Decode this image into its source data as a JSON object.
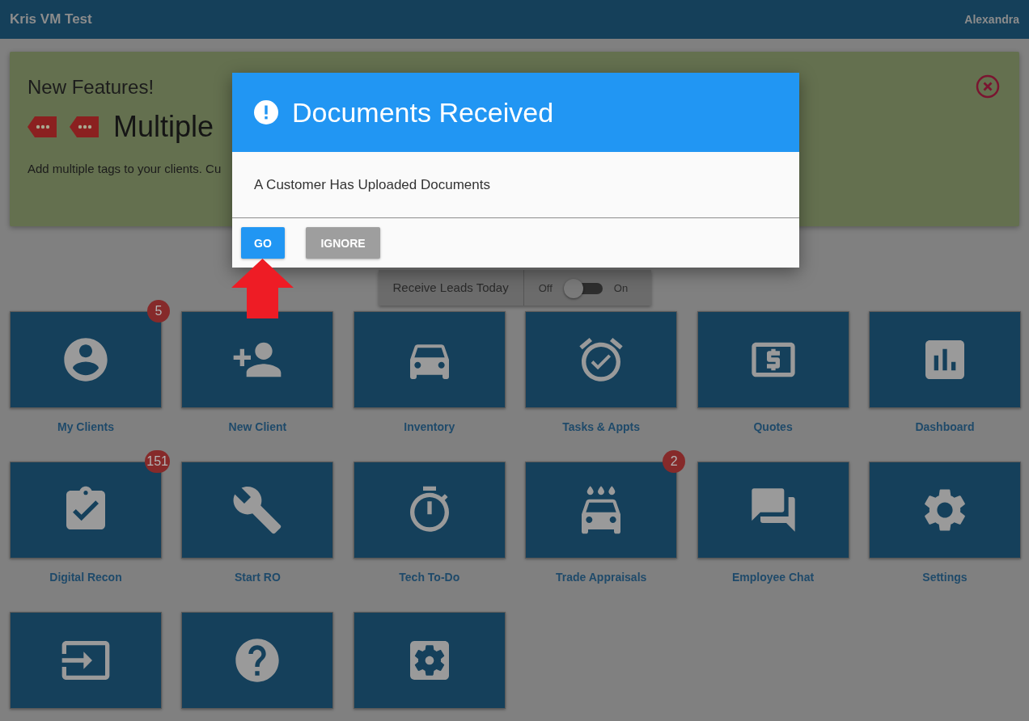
{
  "app_bar": {
    "title": "Kris VM Test",
    "user": "Alexandra"
  },
  "banner": {
    "heading": "New Features!",
    "feature_title": "Multiple",
    "description": "Add multiple tags to your clients. Cu"
  },
  "leads_toggle": {
    "label": "Receive Leads Today",
    "off_label": "Off",
    "on_label": "On",
    "on": false
  },
  "tiles": [
    {
      "label": "My Clients",
      "kind": "person",
      "badge": "5"
    },
    {
      "label": "New Client",
      "kind": "person-add"
    },
    {
      "label": "Inventory",
      "kind": "car"
    },
    {
      "label": "Tasks & Appts",
      "kind": "alarm"
    },
    {
      "label": "Quotes",
      "kind": "money"
    },
    {
      "label": "Dashboard",
      "kind": "chart"
    },
    {
      "label": "Digital Recon",
      "kind": "clipboard",
      "badge": "151"
    },
    {
      "label": "Start RO",
      "kind": "wrench"
    },
    {
      "label": "Tech To-Do",
      "kind": "timer"
    },
    {
      "label": "Trade Appraisals",
      "kind": "carwash",
      "badge": "2"
    },
    {
      "label": "Employee Chat",
      "kind": "chat"
    },
    {
      "label": "Settings",
      "kind": "gear"
    },
    {
      "kind": "enter"
    },
    {
      "kind": "help"
    },
    {
      "kind": "gearbox"
    }
  ],
  "dialog": {
    "title": "Documents Received",
    "message": "A Customer Has Uploaded Documents",
    "buttons": [
      {
        "label": "GO",
        "kind": "primary"
      },
      {
        "label": "IGNORE",
        "kind": "secondary"
      }
    ]
  }
}
